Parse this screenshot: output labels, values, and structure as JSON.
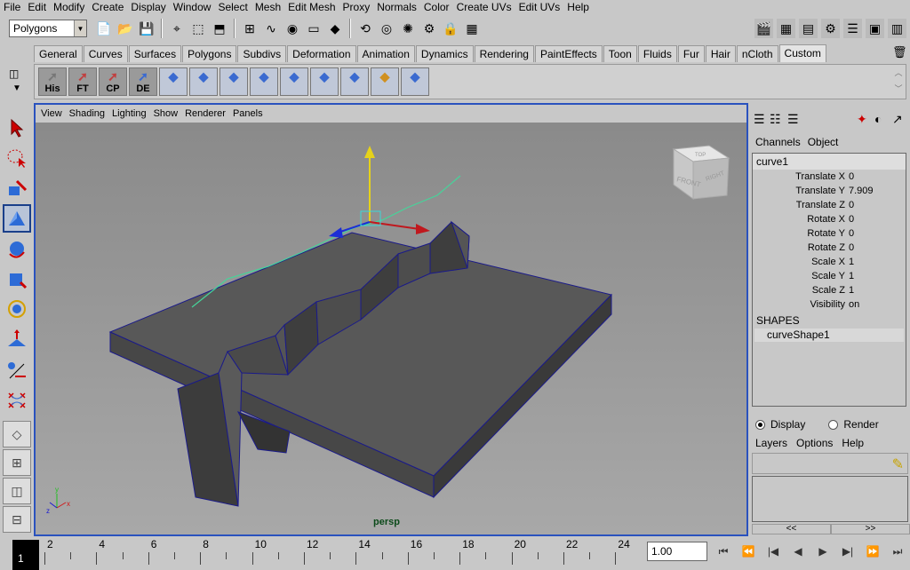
{
  "menubar": [
    "File",
    "Edit",
    "Modify",
    "Create",
    "Display",
    "Window",
    "Select",
    "Mesh",
    "Edit Mesh",
    "Proxy",
    "Normals",
    "Color",
    "Create UVs",
    "Edit UVs",
    "Help"
  ],
  "status_line": {
    "mode": "Polygons",
    "icons": [
      "new-scene-icon",
      "open-scene-icon",
      "save-scene-icon",
      "select-hierarchy-icon",
      "select-object-icon",
      "select-component-icon",
      "snap-grid-icon",
      "snap-curve-icon",
      "snap-point-icon",
      "snap-plane-icon",
      "make-live-icon",
      "history-icon",
      "render-icon",
      "ipr-icon",
      "render-settings-icon",
      "lock-icon",
      "construction-history-icon"
    ]
  },
  "shelf_tabs": [
    "General",
    "Curves",
    "Surfaces",
    "Polygons",
    "Subdivs",
    "Deformation",
    "Animation",
    "Dynamics",
    "Rendering",
    "PaintEffects",
    "Toon",
    "Fluids",
    "Fur",
    "Hair",
    "nCloth",
    "Custom"
  ],
  "shelf_active_tab": "Custom",
  "shelf_buttons": [
    {
      "label": "His",
      "icon": "history-curve-icon"
    },
    {
      "label": "FT",
      "icon": "freeze-transform-icon"
    },
    {
      "label": "CP",
      "icon": "center-pivot-icon"
    },
    {
      "label": "DE",
      "icon": "delete-edges-icon"
    },
    {
      "label": "",
      "icon": "uv-planar-icon"
    },
    {
      "label": "",
      "icon": "uv-editor-icon"
    },
    {
      "label": "",
      "icon": "extrude-icon"
    },
    {
      "label": "",
      "icon": "sphere-uv-icon"
    },
    {
      "label": "",
      "icon": "uv-layout-icon"
    },
    {
      "label": "",
      "icon": "select-uv-icon"
    },
    {
      "label": "",
      "icon": "grid-uv-icon"
    },
    {
      "label": "",
      "icon": "cylinder-uv-icon"
    },
    {
      "label": "",
      "icon": "sew-uv-icon"
    }
  ],
  "panel_menu": [
    "View",
    "Shading",
    "Lighting",
    "Show",
    "Renderer",
    "Panels"
  ],
  "viewport": {
    "camera": "persp",
    "view_cube": {
      "top": "TOP",
      "front": "FRONT",
      "right": "RIGHT"
    }
  },
  "channel_box": {
    "menu": [
      "Channels",
      "Object"
    ],
    "object": "curve1",
    "attributes": [
      {
        "name": "Translate X",
        "value": "0"
      },
      {
        "name": "Translate Y",
        "value": "7.909"
      },
      {
        "name": "Translate Z",
        "value": "0"
      },
      {
        "name": "Rotate X",
        "value": "0"
      },
      {
        "name": "Rotate Y",
        "value": "0"
      },
      {
        "name": "Rotate Z",
        "value": "0"
      },
      {
        "name": "Scale X",
        "value": "1"
      },
      {
        "name": "Scale Y",
        "value": "1"
      },
      {
        "name": "Scale Z",
        "value": "1"
      },
      {
        "name": "Visibility",
        "value": "on"
      }
    ],
    "shapes_header": "SHAPES",
    "shape": "curveShape1"
  },
  "layer_editor": {
    "display_label": "Display",
    "render_label": "Render",
    "menu": [
      "Layers",
      "Options",
      "Help"
    ],
    "pager": [
      "<<",
      ">>"
    ]
  },
  "time_slider": {
    "current_frame": "1",
    "ticks": [
      "2",
      "4",
      "6",
      "8",
      "10",
      "12",
      "14",
      "16",
      "18",
      "20",
      "22",
      "24"
    ],
    "current_time": "1.00"
  },
  "playback": [
    "go-to-start-icon",
    "step-back-key-icon",
    "step-back-frame-icon",
    "play-backward-icon",
    "play-forward-icon",
    "step-forward-frame-icon",
    "step-forward-key-icon",
    "go-to-end-icon"
  ]
}
